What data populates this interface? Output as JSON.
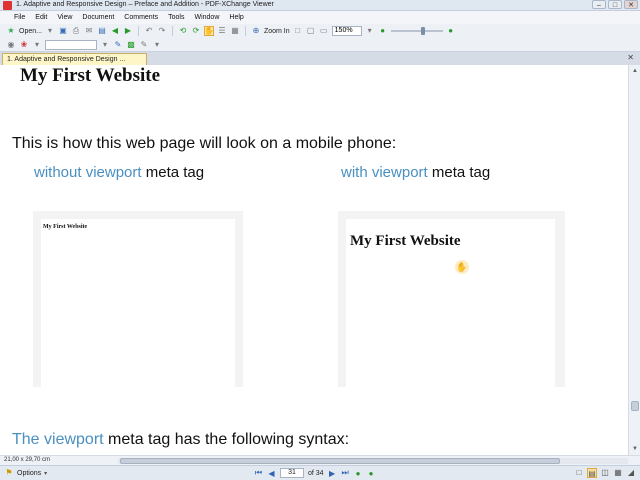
{
  "window": {
    "title": "1. Adaptive and Responsive Design – Preface and Addition - PDF-XChange Viewer",
    "controls": {
      "minimize": "–",
      "maximize": "□",
      "close": "✕"
    }
  },
  "menu": [
    "File",
    "Edit",
    "View",
    "Document",
    "Comments",
    "Tools",
    "Window",
    "Help"
  ],
  "toolbar": {
    "open_label": "Open...",
    "zoom_in_label": "Zoom In",
    "zoom_value": "150%"
  },
  "tab": {
    "label": "1. Adaptive and Responsive Design ...",
    "close": "✕"
  },
  "document": {
    "heading": "My First Website",
    "intro": "This is how this web page will look on a mobile phone:",
    "left_label_highlight": "without viewport",
    "left_label_rest": " meta tag",
    "right_label_highlight": "with viewport",
    "right_label_rest": " meta tag",
    "left_screen_title": "My First Website",
    "right_screen_title": "My First Website",
    "bottom_highlight": "The viewport",
    "bottom_rest": " meta tag has the following syntax:"
  },
  "hbar": {
    "page_size": "21,00 x 29,70 cm"
  },
  "status": {
    "options_label": "Options",
    "current_page": "31",
    "total_pages": "of 34"
  },
  "colors": {
    "link_blue": "#4a8fc0",
    "tab_yellow": "#fff6c8",
    "active_tool": "#ffe7a3"
  }
}
